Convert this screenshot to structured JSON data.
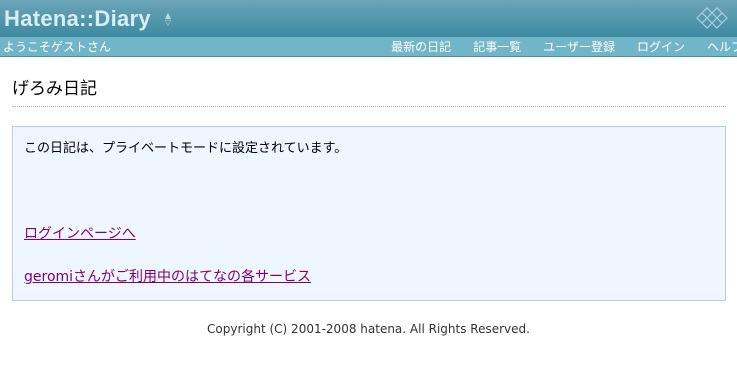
{
  "header": {
    "logo_text": "Hatena::Diary",
    "toggle_glyph_up": "▲",
    "toggle_glyph_down": "▽",
    "brand_mark": "hatena-diamond-icon"
  },
  "navbar": {
    "welcome": "ようこそゲストさん",
    "links": [
      {
        "label": "最新の日記"
      },
      {
        "label": "記事一覧"
      },
      {
        "label": "ユーザー登録"
      },
      {
        "label": "ログイン"
      },
      {
        "label": "ヘルプ"
      }
    ]
  },
  "main": {
    "diary_title": "げろみ日記",
    "notice": "この日記は、プライベートモードに設定されています。",
    "login_link": "ログインページへ",
    "services_link": "geromiさんがご利用中のはてなの各サービス"
  },
  "footer": {
    "copyright": "Copyright (C) 2001-2008 hatena. All Rights Reserved."
  },
  "colors": {
    "banner": "#3d8aa0",
    "navbar": "#71b6c8",
    "link_visited": "#800080",
    "notice_bg": "#eef6ff"
  }
}
